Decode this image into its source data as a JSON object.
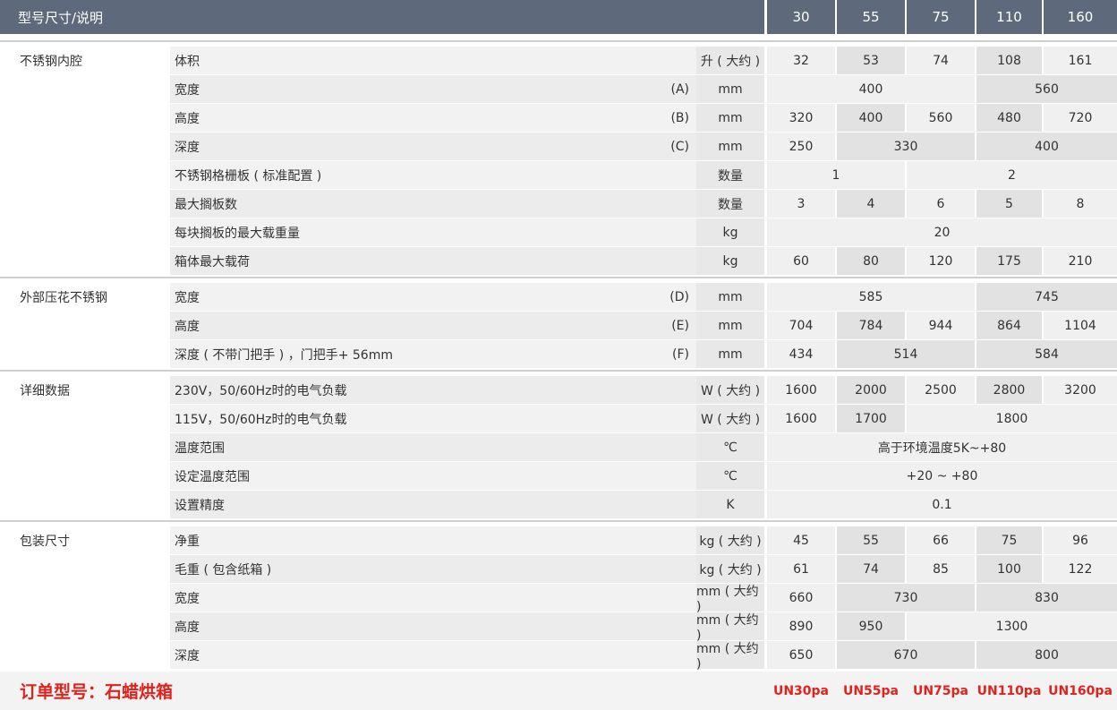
{
  "header": {
    "title": "型号尺寸/说明",
    "models": [
      "30",
      "55",
      "75",
      "110",
      "160"
    ]
  },
  "groups": [
    {
      "label": "不锈钢内腔"
    },
    {
      "label": "外部压花不锈钢"
    },
    {
      "label": "详细数据"
    },
    {
      "label": "包装尺寸"
    }
  ],
  "rows": [
    {
      "param": "体积",
      "sub": "",
      "unit": "升 ( 大约 )",
      "values": [
        "32",
        "53",
        "74",
        "108",
        "161"
      ]
    },
    {
      "param": "宽度",
      "sub": "(A)",
      "unit": "mm",
      "values": [
        "400",
        "560"
      ]
    },
    {
      "param": "高度",
      "sub": "(B)",
      "unit": "mm",
      "values": [
        "320",
        "400",
        "560",
        "480",
        "720"
      ]
    },
    {
      "param": "深度",
      "sub": "(C)",
      "unit": "mm",
      "values": [
        "250",
        "330",
        "400"
      ]
    },
    {
      "param": "不锈钢格栅板 ( 标准配置 )",
      "sub": "",
      "unit": "数量",
      "values": [
        "1",
        "2"
      ]
    },
    {
      "param": "最大搁板数",
      "sub": "",
      "unit": "数量",
      "values": [
        "3",
        "4",
        "6",
        "5",
        "8"
      ]
    },
    {
      "param": "每块搁板的最大载重量",
      "sub": "",
      "unit": "kg",
      "values": [
        "20"
      ]
    },
    {
      "param": "箱体最大载荷",
      "sub": "",
      "unit": "kg",
      "values": [
        "60",
        "80",
        "120",
        "175",
        "210"
      ]
    },
    {
      "param": "宽度",
      "sub": "(D)",
      "unit": "mm",
      "values": [
        "585",
        "745"
      ]
    },
    {
      "param": "高度",
      "sub": "(E)",
      "unit": "mm",
      "values": [
        "704",
        "784",
        "944",
        "864",
        "1104"
      ]
    },
    {
      "param": "深度 ( 不带门把手 ) ，门把手+ 56mm",
      "sub": "(F)",
      "unit": "mm",
      "values": [
        "434",
        "514",
        "584"
      ]
    },
    {
      "param": "230V，50/60Hz时的电气负载",
      "sub": "",
      "unit": "W ( 大约 )",
      "values": [
        "1600",
        "2000",
        "2500",
        "2800",
        "3200"
      ]
    },
    {
      "param": "115V，50/60Hz时的电气负载",
      "sub": "",
      "unit": "W ( 大约 )",
      "values": [
        "1600",
        "1700",
        "1800"
      ]
    },
    {
      "param": "温度范围",
      "sub": "",
      "unit": "℃",
      "values": [
        "高于环境温度5K~+80"
      ]
    },
    {
      "param": "设定温度范围",
      "sub": "",
      "unit": "℃",
      "values": [
        "+20 ~ +80"
      ]
    },
    {
      "param": "设置精度",
      "sub": "",
      "unit": "K",
      "values": [
        "0.1"
      ]
    },
    {
      "param": "净重",
      "sub": "",
      "unit": "kg ( 大约 )",
      "values": [
        "45",
        "55",
        "66",
        "75",
        "96"
      ]
    },
    {
      "param": "毛重 ( 包含纸箱 )",
      "sub": "",
      "unit": "kg ( 大约 )",
      "values": [
        "61",
        "74",
        "85",
        "100",
        "122"
      ]
    },
    {
      "param": "宽度",
      "sub": "",
      "unit": "mm ( 大约 )",
      "values": [
        "660",
        "730",
        "830"
      ]
    },
    {
      "param": "高度",
      "sub": "",
      "unit": "mm ( 大约 )",
      "values": [
        "890",
        "950",
        "1300"
      ]
    },
    {
      "param": "深度",
      "sub": "",
      "unit": "mm ( 大约 )",
      "values": [
        "650",
        "670",
        "800"
      ]
    }
  ],
  "footer": {
    "title": "订单型号：石蜡烘箱",
    "codes": [
      "UN30pa",
      "UN55pa",
      "UN75pa",
      "UN110pa",
      "UN160pa"
    ]
  }
}
